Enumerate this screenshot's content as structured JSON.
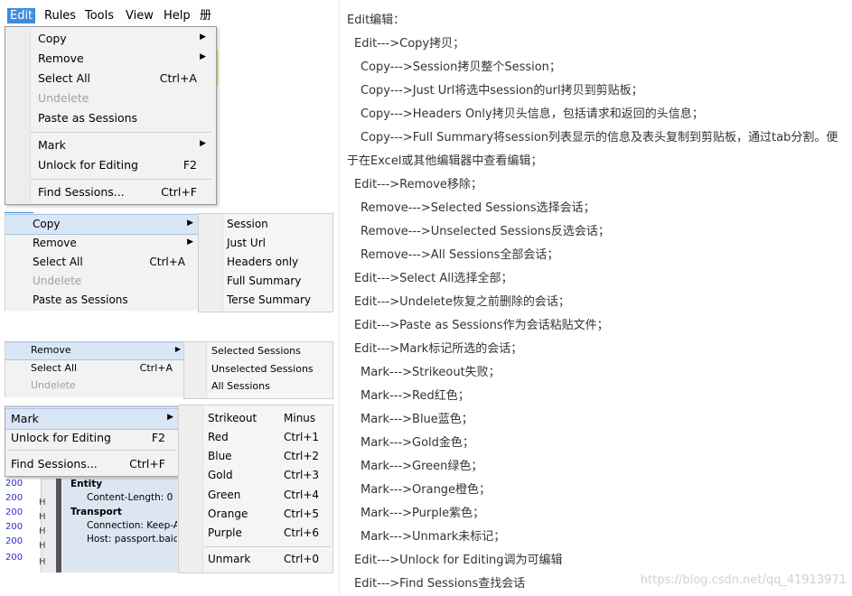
{
  "menubar": {
    "items": [
      "Edit",
      "Rules",
      "Tools",
      "View",
      "Help",
      "册"
    ]
  },
  "edit_menu": {
    "copy": "Copy",
    "remove": "Remove",
    "select_all": "Select All",
    "select_all_shortcut": "Ctrl+A",
    "undelete": "Undelete",
    "paste_as_sessions": "Paste as Sessions",
    "mark": "Mark",
    "unlock_for_editing": "Unlock for Editing",
    "unlock_shortcut": "F2",
    "find_sessions": "Find Sessions...",
    "find_shortcut": "Ctrl+F"
  },
  "copy_submenu": {
    "items": [
      "Session",
      "Just Url",
      "Headers only",
      "Full Summary",
      "Terse Summary"
    ]
  },
  "remove_submenu": {
    "items": [
      "Selected Sessions",
      "Unselected Sessions",
      "All Sessions"
    ]
  },
  "mark_submenu": {
    "items": [
      {
        "label": "Strikeout",
        "shortcut": "Minus"
      },
      {
        "label": "Red",
        "shortcut": "Ctrl+1"
      },
      {
        "label": "Blue",
        "shortcut": "Ctrl+2"
      },
      {
        "label": "Gold",
        "shortcut": "Ctrl+3"
      },
      {
        "label": "Green",
        "shortcut": "Ctrl+4"
      },
      {
        "label": "Orange",
        "shortcut": "Ctrl+5"
      },
      {
        "label": "Purple",
        "shortcut": "Ctrl+6"
      }
    ],
    "unmark": {
      "label": "Unmark",
      "shortcut": "Ctrl+0"
    }
  },
  "session_list": {
    "status_codes": [
      "200",
      "200",
      "200",
      "200",
      "200",
      "200"
    ],
    "host_fragment": "H"
  },
  "detail_pane": {
    "entity_title": "Entity",
    "content_length": "Content-Length: 0",
    "transport_title": "Transport",
    "connection": "Connection: Keep-Aliv",
    "host": "Host: passport.baidu"
  },
  "notes": {
    "lines": [
      "Edit编辑：",
      "Edit--->Copy拷贝；",
      "Copy--->Session拷贝整个Session；",
      "Copy--->Just Url将选中session的url拷贝到剪贴板；",
      "Copy--->Headers Only拷贝头信息，包括请求和返回的头信息；",
      "Copy--->Full Summary将session列表显示的信息及表头复制到剪贴板，通过tab分割。便",
      "于在Excel或其他编辑器中查看编辑；",
      "Edit--->Remove移除；",
      "Remove--->Selected Sessions选择会话；",
      "Remove--->Unselected Sessions反选会话；",
      "Remove--->All Sessions全部会话；",
      "Edit--->Select All选择全部；",
      "Edit--->Undelete恢复之前删除的会话；",
      "Edit--->Paste as Sessions作为会话粘贴文件；",
      "Edit--->Mark标记所选的会话；",
      "Mark--->Strikeout失败；",
      "Mark--->Red红色；",
      "Mark--->Blue蓝色；",
      "Mark--->Gold金色；",
      "Mark--->Green绿色；",
      "Mark--->Orange橙色；",
      "Mark--->Purple紫色；",
      "Mark--->Unmark未标记；",
      "Edit--->Unlock for Editing调为可编辑",
      "Edit--->Find Sessions查找会话"
    ]
  },
  "watermark": "https://blog.csdn.net/qq_41913971",
  "colors": {
    "menu_highlight": "#3c8de0",
    "hover_row": "#d9e6f6",
    "status_blue": "#2b2bd0"
  }
}
